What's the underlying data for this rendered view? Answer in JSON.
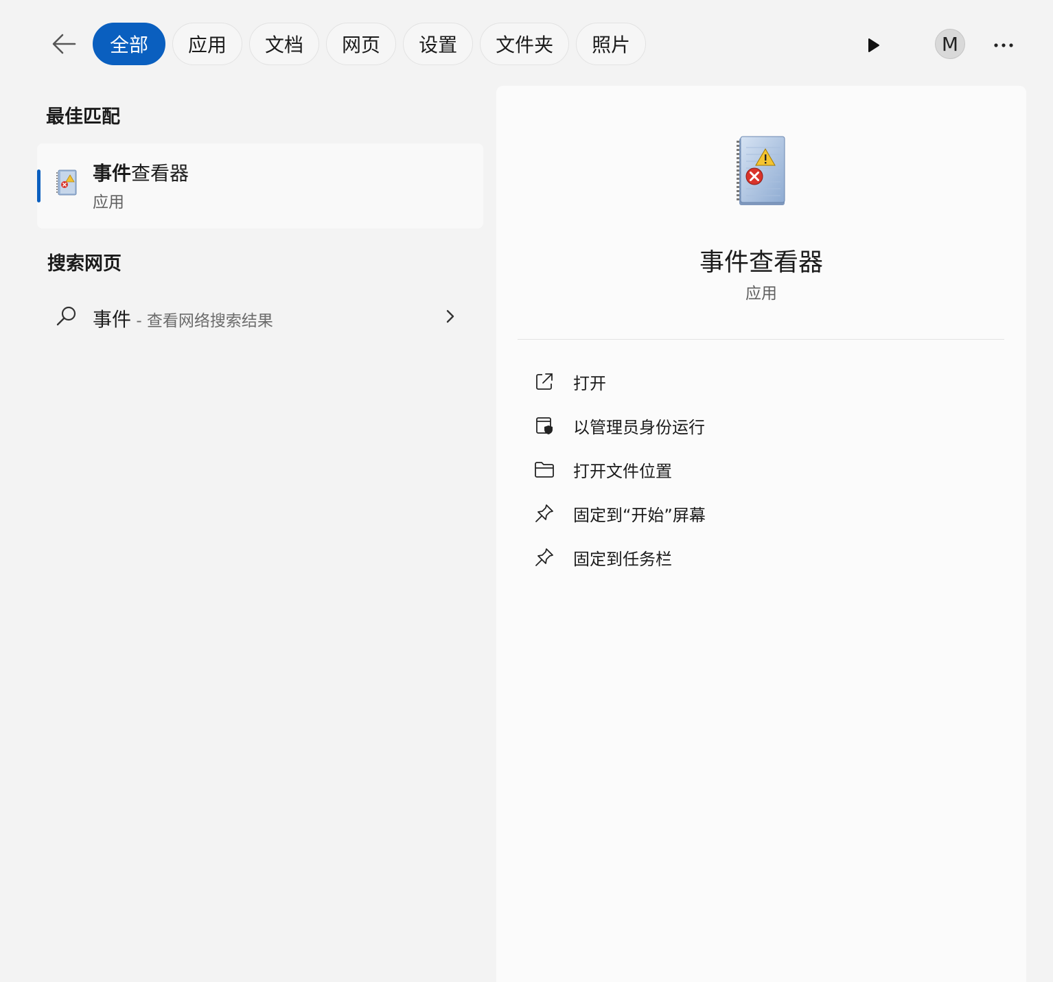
{
  "filters": [
    {
      "label": "全部",
      "active": true
    },
    {
      "label": "应用"
    },
    {
      "label": "文档"
    },
    {
      "label": "网页"
    },
    {
      "label": "设置"
    },
    {
      "label": "文件夹"
    },
    {
      "label": "照片"
    }
  ],
  "user": {
    "avatar_initial": "M"
  },
  "best_match": {
    "section_title": "最佳匹配",
    "title_bold": "事件",
    "title_rest": "查看器",
    "subtitle": "应用"
  },
  "web_search": {
    "section_title": "搜索网页",
    "query": "事件",
    "hint": " - 查看网络搜索结果"
  },
  "detail": {
    "title": "事件查看器",
    "subtitle": "应用",
    "actions": [
      {
        "label": "打开",
        "icon": "open-external-icon"
      },
      {
        "label": "以管理员身份运行",
        "icon": "run-as-admin-icon"
      },
      {
        "label": "打开文件位置",
        "icon": "folder-icon"
      },
      {
        "label": "固定到“开始”屏幕",
        "icon": "pin-icon"
      },
      {
        "label": "固定到任务栏",
        "icon": "pin-icon"
      }
    ]
  },
  "colors": {
    "accent": "#0a5fbf",
    "background": "#f3f3f3",
    "panel": "#fbfbfb"
  },
  "icons": {
    "back": "back-arrow-icon",
    "play": "play-icon",
    "more": "more-icon",
    "search": "search-icon",
    "chevron": "chevron-right-icon",
    "app": "event-viewer-icon"
  }
}
